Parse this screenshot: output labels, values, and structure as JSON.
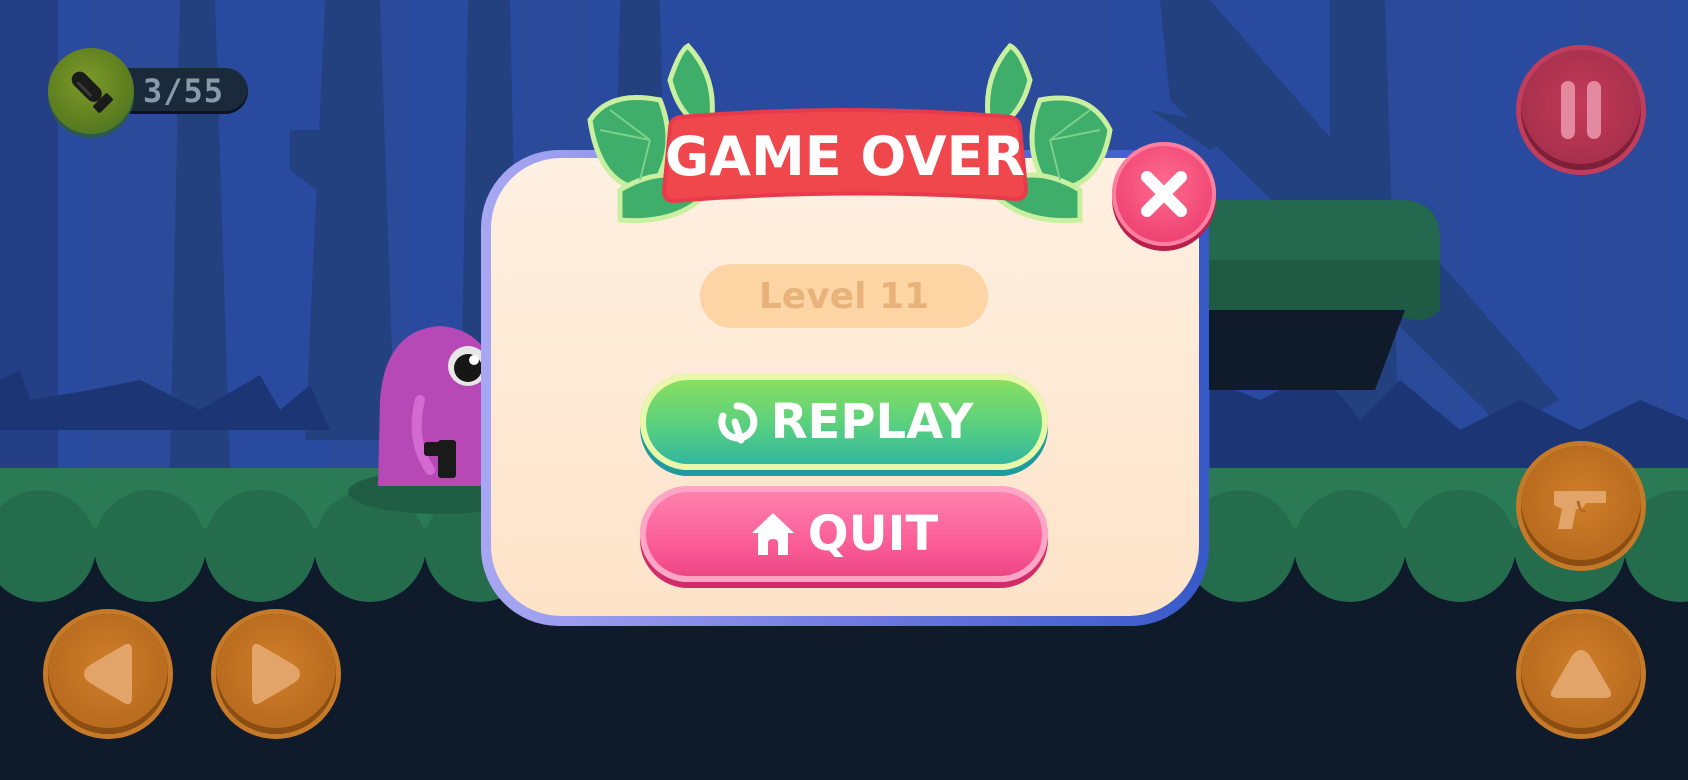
{
  "hud": {
    "ammo_count": "3/55",
    "ammo_icon": "bullet-icon",
    "pause_icon": "pause-icon",
    "left_icon": "arrow-left-icon",
    "right_icon": "arrow-right-icon",
    "shoot_icon": "gun-icon",
    "jump_icon": "arrow-up-icon"
  },
  "dialog": {
    "title": "GAME OVER",
    "level": "Level 11",
    "replay_label": "REPLAY",
    "quit_label": "QUIT",
    "close_icon": "close-icon",
    "replay_icon": "replay-icon",
    "quit_icon": "home-icon"
  },
  "colors": {
    "banner": "#f0474d",
    "replay": "#57cf80",
    "quit": "#fb5d97",
    "close": "#ef4474",
    "hud_orange": "#c67a28",
    "pause": "#c23c5c"
  }
}
